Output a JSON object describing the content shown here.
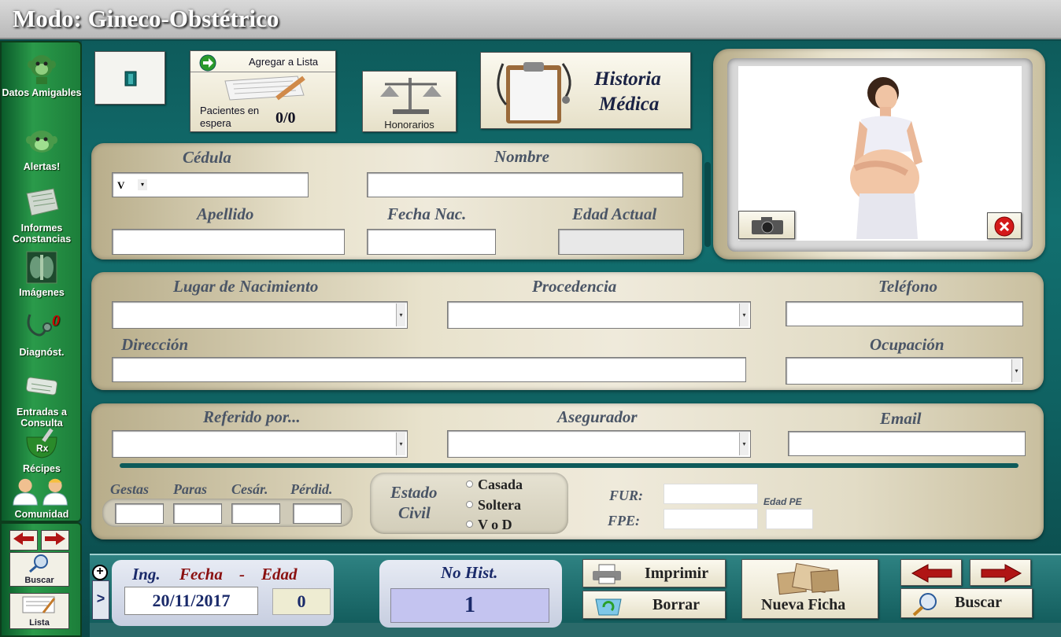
{
  "title": "Modo: Gineco-Obstétrico",
  "sidebar": {
    "items": [
      {
        "label": "Datos Amigables",
        "icon": "monkey-icon"
      },
      {
        "label": "Alertas!",
        "icon": "alert-monkey-icon"
      },
      {
        "label": "Informes Constancias",
        "icon": "document-icon"
      },
      {
        "label": "Imágenes",
        "icon": "xray-icon"
      },
      {
        "label": "Diagnóst.",
        "icon": "stethoscope-icon",
        "badge": "0"
      },
      {
        "label": "Entradas a Consulta",
        "icon": "scroll-icon"
      },
      {
        "label": "Récipes",
        "icon": "mortar-rx-icon"
      },
      {
        "label": "Comunidad",
        "icon": "doctors-icon"
      }
    ]
  },
  "bottom_nav": {
    "buscar": "Buscar",
    "lista": "Lista"
  },
  "toolbar": {
    "agregar_lista": "Agregar a Lista",
    "pacientes_label": "Pacientes en espera",
    "pacientes_count": "0/0",
    "honorarios": "Honorarios",
    "historia": "Historia",
    "medica": "Médica"
  },
  "patient": {
    "cedula_label": "Cédula",
    "cedula_prefix": "V",
    "nombre_label": "Nombre",
    "apellido_label": "Apellido",
    "fecha_nac_label": "Fecha Nac.",
    "edad_actual_label": "Edad Actual"
  },
  "details": {
    "lugar_label": "Lugar de Nacimiento",
    "procedencia_label": "Procedencia",
    "telefono_label": "Teléfono",
    "direccion_label": "Dirección",
    "ocupacion_label": "Ocupación"
  },
  "obstetric": {
    "referido_label": "Referido por...",
    "asegurador_label": "Asegurador",
    "email_label": "Email",
    "gestas_label": "Gestas",
    "paras_label": "Paras",
    "cesar_label": "Cesár.",
    "perdid_label": "Pérdid.",
    "estado_civil_1": "Estado",
    "estado_civil_2": "Civil",
    "casada": "Casada",
    "soltera": "Soltera",
    "vod": "V o D",
    "fur_label": "FUR:",
    "fpe_label": "FPE:",
    "edad_pe_label": "Edad PE"
  },
  "footer": {
    "ing": "Ing.",
    "fecha": "Fecha",
    "dash": "-",
    "edad": "Edad",
    "fecha_value": "20/11/2017",
    "edad_value": "0",
    "no_hist_label": "No Hist.",
    "no_hist_value": "1",
    "imprimir": "Imprimir",
    "borrar": "Borrar",
    "nueva_ficha": "Nueva Ficha",
    "buscar": "Buscar",
    "expand": ">"
  },
  "colors": {
    "background": "#0f6262",
    "sidebar": "#2a9a4a",
    "panel": "#e8e2cc",
    "label": "#4a5566",
    "red_label": "#8a1010",
    "blue_label": "#1a2a6a",
    "hist_box": "#c4c4f0"
  }
}
